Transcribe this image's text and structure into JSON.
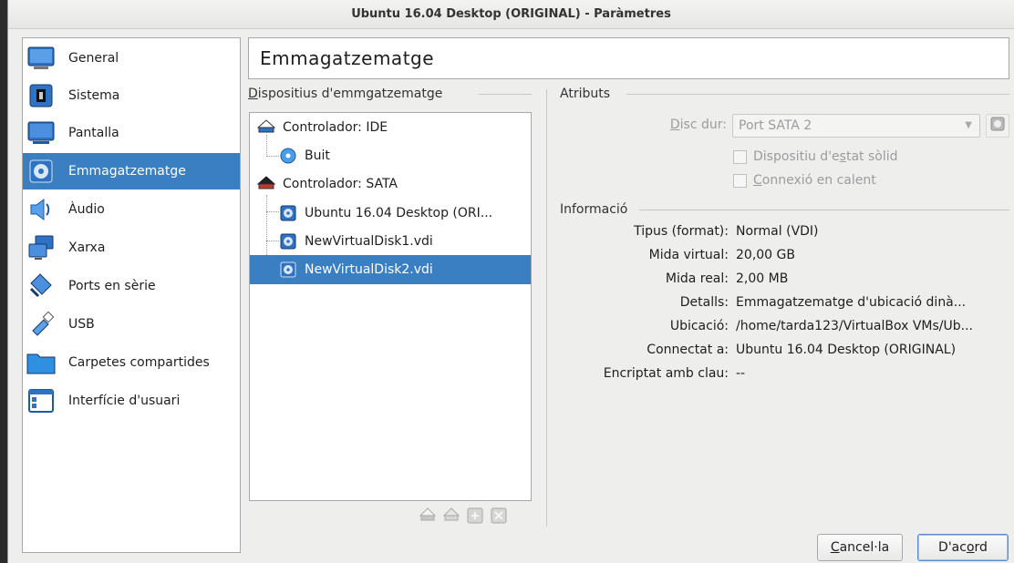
{
  "window": {
    "title": "Ubuntu 16.04 Desktop (ORIGINAL) - Paràmetres"
  },
  "sidebar": {
    "items": [
      {
        "label": "General",
        "icon": "general-icon"
      },
      {
        "label": "Sistema",
        "icon": "system-chip-icon"
      },
      {
        "label": "Pantalla",
        "icon": "display-monitor-icon"
      },
      {
        "label": "Emmagatzematge",
        "icon": "storage-disk-icon",
        "selected": true
      },
      {
        "label": "Àudio",
        "icon": "audio-speaker-icon"
      },
      {
        "label": "Xarxa",
        "icon": "network-icon"
      },
      {
        "label": "Ports en sèrie",
        "icon": "serial-port-icon"
      },
      {
        "label": "USB",
        "icon": "usb-icon"
      },
      {
        "label": "Carpetes compartides",
        "icon": "shared-folder-icon"
      },
      {
        "label": "Interfície d'usuari",
        "icon": "user-interface-icon"
      }
    ]
  },
  "page": {
    "title": "Emmagatzematge"
  },
  "storage": {
    "group_title_prefix": "D",
    "group_title_rest": "ispositius d'emmgatzematge",
    "tree": [
      {
        "label": "Controlador: IDE",
        "type": "controller"
      },
      {
        "label": "Buit",
        "type": "optical"
      },
      {
        "label": "Controlador: SATA",
        "type": "controller"
      },
      {
        "label": "Ubuntu 16.04 Desktop (ORI...",
        "type": "disk"
      },
      {
        "label": "NewVirtualDisk1.vdi",
        "type": "disk"
      },
      {
        "label": "NewVirtualDisk2.vdi",
        "type": "disk",
        "selected": true
      }
    ],
    "toolbar": [
      "add-controller-icon",
      "remove-controller-icon",
      "add-attachment-icon",
      "remove-attachment-icon"
    ]
  },
  "attributes": {
    "title": "Atributs",
    "hard_disk_label_prefix": "D",
    "hard_disk_label_rest": "isc dur:",
    "hard_disk_value": "Port SATA 2",
    "ssd_label_a": "Dispositiu d'e",
    "ssd_label_u": "s",
    "ssd_label_b": "tat sòlid",
    "hotplug_label_u": "C",
    "hotplug_label_rest": "onnexió en calent"
  },
  "information": {
    "title": "Informació",
    "rows": [
      {
        "key": "Tipus (format):",
        "value": "Normal (VDI)"
      },
      {
        "key": "Mida virtual:",
        "value": "20,00 GB"
      },
      {
        "key": "Mida real:",
        "value": "2,00 MB"
      },
      {
        "key": "Detalls:",
        "value": "Emmagatzematge d'ubicació dinà..."
      },
      {
        "key": "Ubicació:",
        "value": "/home/tarda123/VirtualBox VMs/Ub..."
      },
      {
        "key": "Connectat a:",
        "value": "Ubuntu 16.04 Desktop (ORIGINAL)"
      },
      {
        "key": "Encriptat amb clau:",
        "value": "--"
      }
    ]
  },
  "buttons": {
    "cancel_u": "C",
    "cancel_rest": "ancel·la",
    "ok_a": "D'ac",
    "ok_u": "o",
    "ok_b": "rd"
  },
  "colors": {
    "selection": "#3a7fc1",
    "window_bg": "#eeeeec"
  }
}
